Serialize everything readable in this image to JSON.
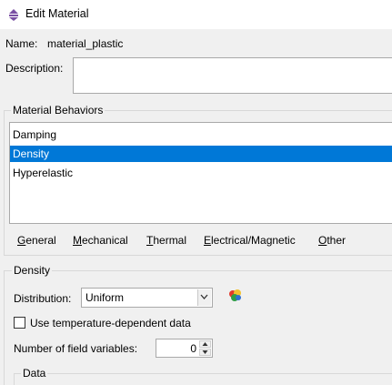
{
  "window": {
    "title": "Edit Material"
  },
  "name": {
    "label": "Name:",
    "value": "material_plastic"
  },
  "description": {
    "label": "Description:",
    "value": ""
  },
  "behaviors": {
    "title": "Material Behaviors",
    "items": [
      {
        "label": "Damping",
        "selected": false
      },
      {
        "label": "Density",
        "selected": true
      },
      {
        "label": "Hyperelastic",
        "selected": false
      }
    ],
    "selection_color": "#0078d7"
  },
  "menu": [
    {
      "label": "General",
      "mnemonic": "G",
      "rest": "eneral"
    },
    {
      "label": "Mechanical",
      "mnemonic": "M",
      "rest": "echanical"
    },
    {
      "label": "Thermal",
      "mnemonic": "T",
      "rest": "hermal"
    },
    {
      "label": "Electrical/Magnetic",
      "mnemonic": "E",
      "rest": "lectrical/Magnetic"
    },
    {
      "label": "Other",
      "mnemonic": "O",
      "rest": "ther"
    }
  ],
  "density": {
    "title": "Density",
    "distribution_label": "Distribution:",
    "distribution_value": "Uniform",
    "temp_dependent_label": "Use temperature-dependent data",
    "temp_dependent_checked": false,
    "field_vars_label": "Number of field variables:",
    "field_vars_value": "0",
    "data_title": "Data"
  },
  "icons": {
    "window": "edit-material-icon",
    "distribution": "create-analytical-field-icon"
  }
}
